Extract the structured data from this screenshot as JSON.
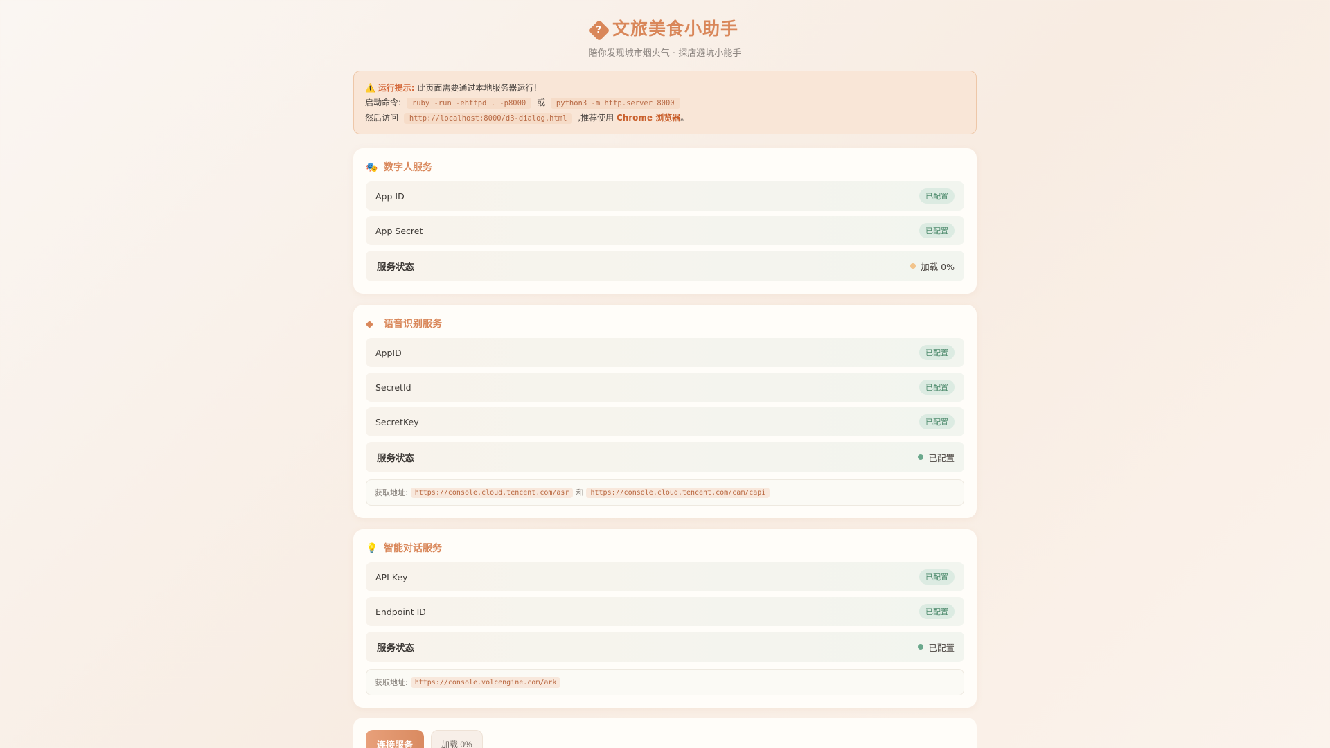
{
  "header": {
    "icon": "diamond-question-icon",
    "title": "文旅美食小助手",
    "subtitle": "陪你发现城市烟火气 · 探店避坑小能手"
  },
  "notice": {
    "warn_icon": "warning-icon",
    "warn_label": "运行提示:",
    "line1_text": "此页面需要通过本地服务器运行!",
    "line2_prefix": "启动命令:",
    "cmd1": "ruby -run -ehttpd . -p8000",
    "or": "或",
    "cmd2": "python3 -m http.server 8000",
    "line3_prefix": "然后访问",
    "url": "http://localhost:8000/d3-dialog.html",
    "line3_mid": ",推荐使用",
    "browser": "Chrome 浏览器",
    "line3_end": "。"
  },
  "cards": [
    {
      "icon": "masks-icon",
      "icon_glyph": "🎭",
      "title": "数字人服务",
      "rows": [
        {
          "label": "App ID",
          "badge": "已配置"
        },
        {
          "label": "App Secret",
          "badge": "已配置"
        }
      ],
      "status_label": "服务状态",
      "status_text": "加载 0%",
      "status_color": "#f2c48c"
    },
    {
      "icon": "diamond-question-icon",
      "icon_glyph": "◆",
      "title": "语音识别服务",
      "rows": [
        {
          "label": "AppID",
          "badge": "已配置"
        },
        {
          "label": "SecretId",
          "badge": "已配置"
        },
        {
          "label": "SecretKey",
          "badge": "已配置"
        }
      ],
      "status_label": "服务状态",
      "status_text": "已配置",
      "status_color": "#6aa88c",
      "addr_label": "获取地址:",
      "addr_links": [
        "https://console.cloud.tencent.com/asr",
        "https://console.cloud.tencent.com/cam/capi"
      ],
      "addr_and": "和"
    },
    {
      "icon": "lightbulb-icon",
      "icon_glyph": "💡",
      "title": "智能对话服务",
      "rows": [
        {
          "label": "API Key",
          "badge": "已配置"
        },
        {
          "label": "Endpoint ID",
          "badge": "已配置"
        }
      ],
      "status_label": "服务状态",
      "status_text": "已配置",
      "status_color": "#6aa88c",
      "addr_label": "获取地址:",
      "addr_links": [
        "https://console.volcengine.com/ark"
      ]
    }
  ],
  "actions": {
    "connect_label": "连接服务",
    "loading_label": "加载 0%"
  }
}
